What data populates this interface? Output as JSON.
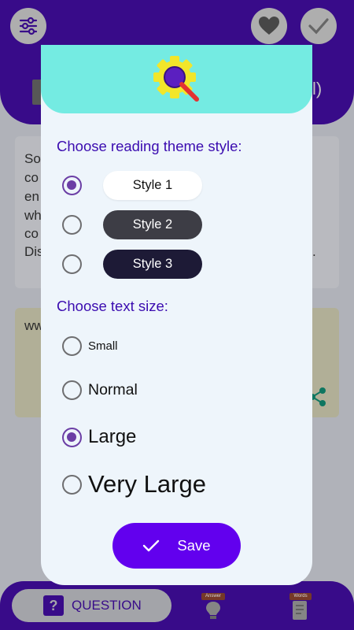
{
  "background": {
    "card1_text": [
      "So",
      "co",
      "en",
      "wh",
      "co",
      "Dis"
    ],
    "card1_trail": "l)",
    "card1_dot": ".",
    "card2_text": "ww",
    "bottom_nav": {
      "question_label": "QUESTION",
      "question_icon": "?",
      "answer_badge": "Answer",
      "words_badge": "Words"
    }
  },
  "dialog": {
    "header_icon": "gear-search-icon",
    "theme_section_title": "Choose reading theme style:",
    "themes": [
      {
        "label": "Style 1",
        "selected": true
      },
      {
        "label": "Style 2",
        "selected": false
      },
      {
        "label": "Style 3",
        "selected": false
      }
    ],
    "size_section_title": "Choose text size:",
    "sizes": [
      {
        "label": "Small",
        "selected": false
      },
      {
        "label": "Normal",
        "selected": false
      },
      {
        "label": "Large",
        "selected": true
      },
      {
        "label": "Very Large",
        "selected": false
      }
    ],
    "save_label": "Save"
  },
  "colors": {
    "accent": "#6200ee",
    "header_purple": "#3a0c8e",
    "dialog_header": "#74ebe2",
    "radio_selected": "#6b3ea5"
  }
}
